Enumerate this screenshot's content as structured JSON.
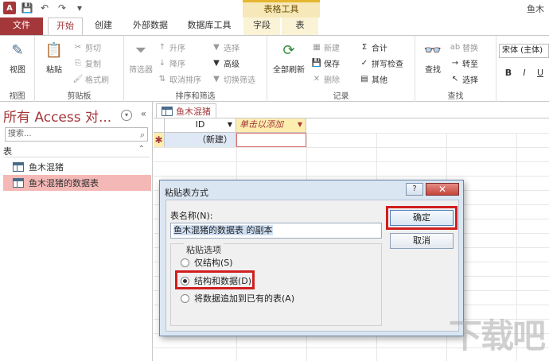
{
  "titlebar": {
    "context_group": "表格工具",
    "window_title": "鱼木"
  },
  "tabs": {
    "file": "文件",
    "home": "开始",
    "create": "创建",
    "external": "外部数据",
    "dbtools": "数据库工具",
    "fields": "字段",
    "table": "表"
  },
  "ribbon": {
    "view": {
      "label": "视图",
      "group": "视图"
    },
    "clipboard": {
      "paste": "粘贴",
      "cut": "剪切",
      "copy": "复制",
      "format_painter": "格式刷",
      "group": "剪贴板"
    },
    "sort_filter": {
      "filter": "筛选器",
      "ascending": "升序",
      "descending": "降序",
      "remove_sort": "取消排序",
      "selection": "选择",
      "advanced": "高级",
      "toggle_filter": "切换筛选",
      "group": "排序和筛选"
    },
    "records": {
      "refresh_all": "全部刷新",
      "new": "新建",
      "save": "保存",
      "delete": "删除",
      "totals": "合计",
      "spelling": "拼写检查",
      "more": "其他",
      "group": "记录"
    },
    "find": {
      "find": "查找",
      "replace": "替换",
      "goto": "转至",
      "select": "选择",
      "group": "查找"
    },
    "text": {
      "font": "宋体 (主体)",
      "bold": "B",
      "italic": "I",
      "underline": "U"
    }
  },
  "nav": {
    "title": "所有 Access 对...",
    "search_placeholder": "搜索...",
    "section": "表",
    "items": [
      {
        "label": "鱼木混猪"
      },
      {
        "label": "鱼木混猪的数据表"
      }
    ]
  },
  "document": {
    "tab_label": "鱼木混猪",
    "col_id": "ID",
    "col_add": "单击以添加",
    "new_row_marker": "✱",
    "new_row_value": "（新建）"
  },
  "dialog": {
    "title": "粘贴表方式",
    "help": "?",
    "close": "✕",
    "name_label": "表名称(N):",
    "name_value": "鱼木混猪的数据表 的副本",
    "options_legend": "粘贴选项",
    "options": [
      {
        "label": "仅结构(S)",
        "selected": false
      },
      {
        "label": "结构和数据(D)",
        "selected": true
      },
      {
        "label": "将数据追加到已有的表(A)",
        "selected": false
      }
    ],
    "ok": "确定",
    "cancel": "取消"
  },
  "watermark": "下载吧",
  "colors": {
    "accent": "#a4373a",
    "highlight": "#d11e1e",
    "dialog_bg": "#dbe6f3"
  }
}
